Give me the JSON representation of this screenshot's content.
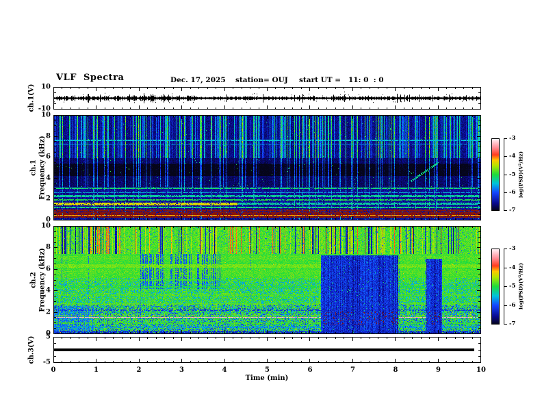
{
  "header": {
    "title": "VLF Spectra",
    "date": "Dec. 17, 2025",
    "station": "station= OUJ",
    "start_ut": "start UT =   11: 0  : 0"
  },
  "x_axis": {
    "axis_label": "Time (min)",
    "min": 0,
    "max": 10,
    "tick_values": [
      0,
      1,
      2,
      3,
      4,
      5,
      6,
      7,
      8,
      9,
      10
    ],
    "tick_labels": [
      "0",
      "1",
      "2",
      "3",
      "4",
      "5",
      "6",
      "7",
      "8",
      "9",
      "10"
    ],
    "minor_step": 0.2
  },
  "panels": [
    {
      "name": "ch1-waveform",
      "side_label": "ch.1(V)",
      "ymin": -10,
      "ymax": 10,
      "ytick_values": [
        10,
        -10
      ],
      "ytick_labels": [
        "10",
        "-10"
      ],
      "yminor_values": [
        5,
        0,
        -5
      ]
    },
    {
      "name": "ch1-spectrogram",
      "side_label_channel": "ch.1",
      "side_label_axis": "Frequency (kHz)",
      "ymin": 0,
      "ymax": 10,
      "ytick_values": [
        10,
        8,
        6,
        4,
        2,
        0
      ],
      "ytick_labels": [
        "10",
        "8",
        "6",
        "4",
        "2",
        "0"
      ],
      "yminor_step": 0.5
    },
    {
      "name": "ch2-spectrogram",
      "side_label_channel": "ch.2",
      "side_label_axis": "Frequency (kHz)",
      "ymin": 0,
      "ymax": 10,
      "ytick_values": [
        10,
        8,
        6,
        4,
        2,
        0
      ],
      "ytick_labels": [
        "10",
        "8",
        "6",
        "4",
        "2",
        "0"
      ],
      "yminor_step": 0.5
    },
    {
      "name": "ch3-waveform",
      "side_label": "ch.3(V)",
      "ymin": -5,
      "ymax": 5,
      "ytick_values": [
        5,
        -5
      ],
      "ytick_labels": [
        "5",
        "-5"
      ],
      "yminor_values": [
        2.5,
        0,
        -2.5
      ]
    }
  ],
  "colorbars": [
    {
      "unit_label": "log(PSD)(V²/Hz)",
      "tick_labels": [
        "-3",
        "-4",
        "-5",
        "-6",
        "-7"
      ],
      "tick_values": [
        -3,
        -4,
        -5,
        -6,
        -7
      ]
    },
    {
      "unit_label": "log(PSD)(V²/Hz)",
      "tick_labels": [
        "-3",
        "-4",
        "-5",
        "-6",
        "-7"
      ],
      "tick_values": [
        -3,
        -4,
        -5,
        -6,
        -7
      ]
    }
  ],
  "colormap": [
    {
      "v": -7.0,
      "c": "#050519"
    },
    {
      "v": -6.6,
      "c": "#0a0a8c"
    },
    {
      "v": -6.0,
      "c": "#1446ff"
    },
    {
      "v": -5.5,
      "c": "#00c3dc"
    },
    {
      "v": -5.0,
      "c": "#1edc3c"
    },
    {
      "v": -4.5,
      "c": "#b4e600"
    },
    {
      "v": -4.2,
      "c": "#ffc800"
    },
    {
      "v": -3.9,
      "c": "#ff3c1e"
    },
    {
      "v": -3.5,
      "c": "#ff8c96"
    },
    {
      "v": -3.0,
      "c": "#fff5fa"
    }
  ],
  "chart_data": [
    {
      "type": "line",
      "panel": "ch1_waveform",
      "ylabel": "ch.1(V)",
      "ylim": [
        -10,
        10
      ],
      "xlim_min": [
        0,
        10
      ],
      "summary": "Continuous noisy trace centered on 0 V, peak-to-peak mostly under 4 V, denser/larger bursts during minutes 0-3.5, small spikes throughout."
    },
    {
      "type": "heatmap",
      "panel": "ch1_spectrogram",
      "ylabel": "Frequency (kHz)",
      "ylim": [
        0,
        10
      ],
      "xlim_min": [
        0,
        10
      ],
      "zlabel": "log(PSD)(V²/Hz)",
      "zlim": [
        -7,
        -3
      ],
      "summary": "Dark navy background with dense vertical broadband sferic impulses (blue/cyan/green) brightest above 6 kHz; darker band 3-6 kHz; horizontal emission lines below 3 kHz; dark-red/maroon band near 0.2-1 kHz; bright yellow line near 1.55 kHz fading after ~4.3 min; faint rising tone 8.35-9 min from ~3.7 to 5.5 kHz.",
      "h_lines_khz": [
        7.6,
        7.25,
        3.05,
        2.6,
        2.3,
        1.95,
        1.55,
        1.2,
        0.9,
        0.55,
        0.45,
        0.3
      ],
      "rising_tone": {
        "t_min": [
          8.35,
          9.0
        ],
        "f_khz": [
          3.7,
          5.5
        ]
      }
    },
    {
      "type": "heatmap",
      "panel": "ch2_spectrogram",
      "ylabel": "Frequency (kHz)",
      "ylim": [
        0,
        10
      ],
      "xlim_min": [
        0,
        10
      ],
      "zlabel": "log(PSD)(V²/Hz)",
      "zlim": [
        -7,
        -3
      ],
      "summary": "Bright green background; vertical yellow/orange/dark streaks above ~7.4 kHz; yellow-green band near 6.3 kHz; cyan/blue mottling below 5 kHz with blue patch near 0-1 min below 2.6 kHz; thin horizontal lines (incl. whitish line near 1.5 kHz); dark-blue dropout blocks ~6.25-8.05 min and ~8.7-9.1 min below ~7.3 kHz with maroon patches 0.8-2.1 kHz; scattered blue streaks 2-3.9 min between 4.2-7.5 kHz.",
      "h_lines_khz": [
        6.3,
        5.0,
        4.35,
        3.6,
        2.75,
        2.2,
        1.65,
        1.5,
        1.0,
        0.6
      ],
      "dropout_blocks": [
        {
          "t_min": [
            6.25,
            8.05
          ],
          "f_khz": [
            0,
            7.3
          ]
        },
        {
          "t_min": [
            8.72,
            9.08
          ],
          "f_khz": [
            0,
            7.0
          ]
        }
      ]
    },
    {
      "type": "line",
      "panel": "ch3_waveform",
      "ylabel": "ch.3(V)",
      "ylim": [
        -5,
        5
      ],
      "xlim_min": [
        0,
        10
      ],
      "end_min": 9.85,
      "summary": "Flat thick line at ~0 V extending from 0 to ~9.85 min."
    }
  ]
}
